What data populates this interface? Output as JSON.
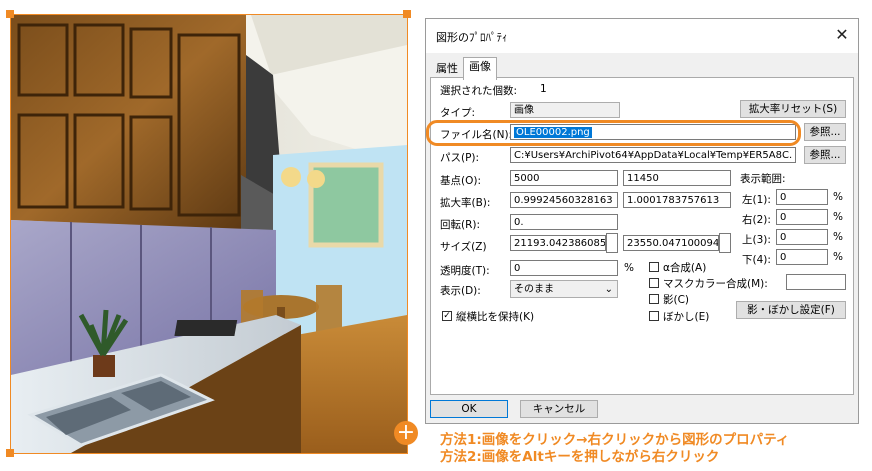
{
  "dialog": {
    "title": "図形のﾌﾟﾛﾊﾟﾃｨ",
    "close_glyph": "✕",
    "tabs": [
      "属性",
      "画像"
    ],
    "selected_count_label": "選択された個数:",
    "selected_count_value": "1",
    "type_label": "タイプ:",
    "type_value": "画像",
    "reset_zoom_button": "拡大率リセット(S)",
    "filename_label": "ファイル名(N):",
    "filename_value": "OLE00002.png",
    "browse_button": "参照...",
    "path_label": "パス(P):",
    "path_value": "C:¥Users¥ArchiPivot64¥AppData¥Local¥Temp¥ER5A8C.",
    "browse_button2": "参照...",
    "base_point_label": "基点(O):",
    "base_x": "5000",
    "base_y": "11450",
    "zoom_label": "拡大率(B):",
    "zoom_x": "0.99924560328163",
    "zoom_y": "1.0001783757613",
    "rotation_label": "回転(R):",
    "rotation_value": "0.",
    "size_label": "サイズ(Z)",
    "size_x": "21193.042386085",
    "size_y": "23550.047100094",
    "transparency_label": "透明度(T):",
    "transparency_value": "0",
    "percent": "%",
    "display_label": "表示(D):",
    "display_value": "そのまま",
    "keep_aspect_label": "縦横比を保持(K)",
    "keep_aspect_checked": true,
    "display_range_label": "表示範囲:",
    "range_left_label": "左(1):",
    "range_left_value": "0",
    "range_right_label": "右(2):",
    "range_right_value": "0",
    "range_top_label": "上(3):",
    "range_top_value": "0",
    "range_bottom_label": "下(4):",
    "range_bottom_value": "0",
    "alpha_label": "α合成(A)",
    "mask_label": "マスクカラー合成(M):",
    "shadow_label": "影(C)",
    "blur_label": "ぼかし(E)",
    "shadow_blur_button": "影・ぼかし設定(F)",
    "ok_button": "OK",
    "cancel_button": "キャンセル"
  },
  "notes": {
    "method1": "方法1:画像をクリック→右クリックから図形のプロパティ",
    "method2": "方法2:画像をAltキーを押しながら右クリック"
  },
  "colors": {
    "accent": "#f08a24",
    "selection": "#0078d7"
  },
  "icons": {
    "move": "plus-move-icon",
    "spin": "spin-arrow-icon",
    "dropdown": "chevron-down-icon"
  }
}
